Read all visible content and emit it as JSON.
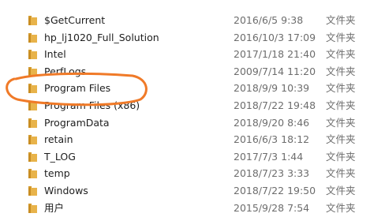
{
  "file_list": {
    "rows": [
      {
        "name": "$GetCurrent",
        "date": "2016/6/5 9:38",
        "type": "文件夹"
      },
      {
        "name": "hp_lj1020_Full_Solution",
        "date": "2016/10/3 17:09",
        "type": "文件夹"
      },
      {
        "name": "Intel",
        "date": "2017/1/18 21:40",
        "type": "文件夹"
      },
      {
        "name": "PerfLogs",
        "date": "2009/7/14 11:20",
        "type": "文件夹"
      },
      {
        "name": "Program Files",
        "date": "2018/9/9 10:39",
        "type": "文件夹"
      },
      {
        "name": "Program Files (x86)",
        "date": "2018/7/22 19:48",
        "type": "文件夹"
      },
      {
        "name": "ProgramData",
        "date": "2018/9/20 8:46",
        "type": "文件夹"
      },
      {
        "name": "retain",
        "date": "2016/6/3 18:12",
        "type": "文件夹"
      },
      {
        "name": "T_LOG",
        "date": "2017/7/3 1:44",
        "type": "文件夹"
      },
      {
        "name": "temp",
        "date": "2018/7/23 3:33",
        "type": "文件夹"
      },
      {
        "name": "Windows",
        "date": "2018/7/22 19:50",
        "type": "文件夹"
      },
      {
        "name": "用户",
        "date": "2015/9/28 7:54",
        "type": "文件夹"
      }
    ]
  },
  "colors": {
    "annotation": "#f07a28",
    "folder_body": "#e8b34a",
    "folder_tab": "#d39a2c"
  },
  "icons": {
    "folder": "folder-icon"
  }
}
